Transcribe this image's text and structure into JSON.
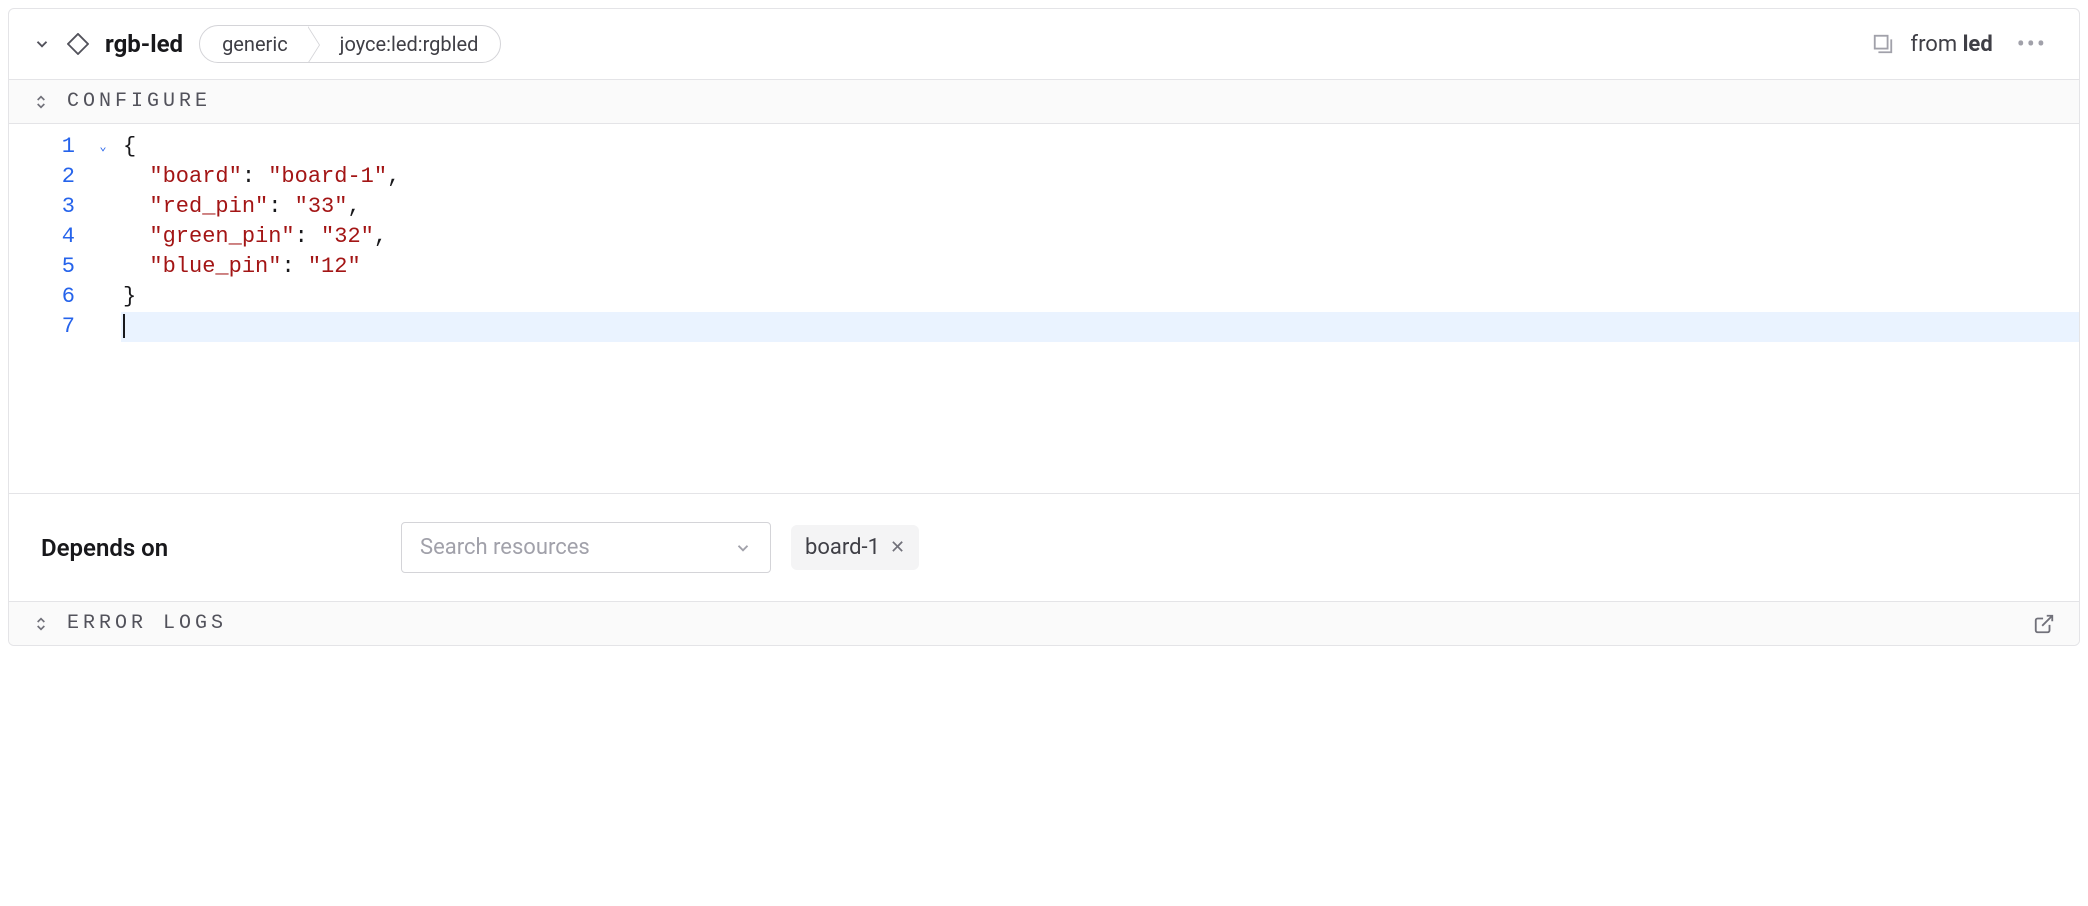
{
  "header": {
    "component_name": "rgb-led",
    "breadcrumb": {
      "segment1": "generic",
      "segment2": "joyce:led:rgbled"
    },
    "from_prefix": "from ",
    "from_module": "led"
  },
  "configure": {
    "title": "CONFIGURE",
    "line_numbers": [
      "1",
      "2",
      "3",
      "4",
      "5",
      "6",
      "7"
    ],
    "json": {
      "board_key": "\"board\"",
      "board_val": "\"board-1\"",
      "red_key": "\"red_pin\"",
      "red_val": "\"33\"",
      "green_key": "\"green_pin\"",
      "green_val": "\"32\"",
      "blue_key": "\"blue_pin\"",
      "blue_val": "\"12\""
    },
    "punct": {
      "open": "{",
      "close": "}",
      "colon_comma": ": ",
      "comma": ",",
      "colon": ": "
    }
  },
  "depends": {
    "label": "Depends on",
    "placeholder": "Search resources",
    "chip": "board-1"
  },
  "error_logs": {
    "title": "ERROR LOGS"
  }
}
